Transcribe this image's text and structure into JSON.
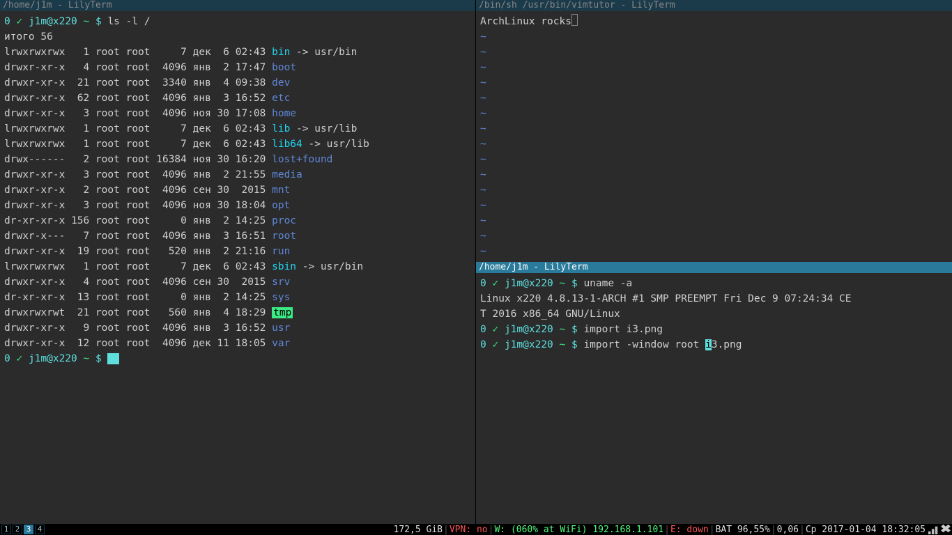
{
  "panes": {
    "left": {
      "title": "/home/j1m - LilyTerm",
      "prompt": {
        "status": "0",
        "tick": "✓",
        "userhost": "j1m@x220",
        "path": "~",
        "dollar": "$"
      },
      "cmd": "ls -l /",
      "total": "итого 56",
      "rows": [
        {
          "perm": "lrwxrwxrwx",
          "lnk": "1",
          "own": "root root",
          "size": "7",
          "mon": "дек",
          "day": "6",
          "time": "02:43",
          "name": "bin",
          "link": " -> usr/bin",
          "cls": "p-cyan"
        },
        {
          "perm": "drwxr-xr-x",
          "lnk": "4",
          "own": "root root",
          "size": "4096",
          "mon": "янв",
          "day": "2",
          "time": "17:47",
          "name": "boot",
          "link": "",
          "cls": "p-blue"
        },
        {
          "perm": "drwxr-xr-x",
          "lnk": "21",
          "own": "root root",
          "size": "3340",
          "mon": "янв",
          "day": "4",
          "time": "09:38",
          "name": "dev",
          "link": "",
          "cls": "p-blue"
        },
        {
          "perm": "drwxr-xr-x",
          "lnk": "62",
          "own": "root root",
          "size": "4096",
          "mon": "янв",
          "day": "3",
          "time": "16:52",
          "name": "etc",
          "link": "",
          "cls": "p-blue"
        },
        {
          "perm": "drwxr-xr-x",
          "lnk": "3",
          "own": "root root",
          "size": "4096",
          "mon": "ноя",
          "day": "30",
          "time": "17:08",
          "name": "home",
          "link": "",
          "cls": "p-blue"
        },
        {
          "perm": "lrwxrwxrwx",
          "lnk": "1",
          "own": "root root",
          "size": "7",
          "mon": "дек",
          "day": "6",
          "time": "02:43",
          "name": "lib",
          "link": " -> usr/lib",
          "cls": "p-cyan"
        },
        {
          "perm": "lrwxrwxrwx",
          "lnk": "1",
          "own": "root root",
          "size": "7",
          "mon": "дек",
          "day": "6",
          "time": "02:43",
          "name": "lib64",
          "link": " -> usr/lib",
          "cls": "p-cyan"
        },
        {
          "perm": "drwx------",
          "lnk": "2",
          "own": "root root",
          "size": "16384",
          "mon": "ноя",
          "day": "30",
          "time": "16:20",
          "name": "lost+found",
          "link": "",
          "cls": "p-blue"
        },
        {
          "perm": "drwxr-xr-x",
          "lnk": "3",
          "own": "root root",
          "size": "4096",
          "mon": "янв",
          "day": "2",
          "time": "21:55",
          "name": "media",
          "link": "",
          "cls": "p-blue"
        },
        {
          "perm": "drwxr-xr-x",
          "lnk": "2",
          "own": "root root",
          "size": "4096",
          "mon": "сен",
          "day": "30",
          "time": " 2015",
          "name": "mnt",
          "link": "",
          "cls": "p-blue"
        },
        {
          "perm": "drwxr-xr-x",
          "lnk": "3",
          "own": "root root",
          "size": "4096",
          "mon": "ноя",
          "day": "30",
          "time": "18:04",
          "name": "opt",
          "link": "",
          "cls": "p-blue"
        },
        {
          "perm": "dr-xr-xr-x",
          "lnk": "156",
          "own": "root root",
          "size": "0",
          "mon": "янв",
          "day": "2",
          "time": "14:25",
          "name": "proc",
          "link": "",
          "cls": "p-blue"
        },
        {
          "perm": "drwxr-x---",
          "lnk": "7",
          "own": "root root",
          "size": "4096",
          "mon": "янв",
          "day": "3",
          "time": "16:51",
          "name": "root",
          "link": "",
          "cls": "p-blue"
        },
        {
          "perm": "drwxr-xr-x",
          "lnk": "19",
          "own": "root root",
          "size": "520",
          "mon": "янв",
          "day": "2",
          "time": "21:16",
          "name": "run",
          "link": "",
          "cls": "p-blue"
        },
        {
          "perm": "lrwxrwxrwx",
          "lnk": "1",
          "own": "root root",
          "size": "7",
          "mon": "дек",
          "day": "6",
          "time": "02:43",
          "name": "sbin",
          "link": " -> usr/bin",
          "cls": "p-cyan"
        },
        {
          "perm": "drwxr-xr-x",
          "lnk": "4",
          "own": "root root",
          "size": "4096",
          "mon": "сен",
          "day": "30",
          "time": " 2015",
          "name": "srv",
          "link": "",
          "cls": "p-blue"
        },
        {
          "perm": "dr-xr-xr-x",
          "lnk": "13",
          "own": "root root",
          "size": "0",
          "mon": "янв",
          "day": "2",
          "time": "14:25",
          "name": "sys",
          "link": "",
          "cls": "p-blue"
        },
        {
          "perm": "drwxrwxrwt",
          "lnk": "21",
          "own": "root root",
          "size": "560",
          "mon": "янв",
          "day": "4",
          "time": "18:29",
          "name": "tmp",
          "link": "",
          "cls": "p-tmp"
        },
        {
          "perm": "drwxr-xr-x",
          "lnk": "9",
          "own": "root root",
          "size": "4096",
          "mon": "янв",
          "day": "3",
          "time": "16:52",
          "name": "usr",
          "link": "",
          "cls": "p-blue"
        },
        {
          "perm": "drwxr-xr-x",
          "lnk": "12",
          "own": "root root",
          "size": "4096",
          "mon": "дек",
          "day": "11",
          "time": "18:05",
          "name": "var",
          "link": "",
          "cls": "p-blue"
        }
      ]
    },
    "right_top": {
      "title": "/bin/sh /usr/bin/vimtutor - LilyTerm",
      "text": "ArchLinux rocks"
    },
    "right_bottom": {
      "title": "/home/j1m - LilyTerm",
      "lines": {
        "cmd1": "uname -a",
        "out1a": "Linux x220 4.8.13-1-ARCH #1 SMP PREEMPT Fri Dec 9 07:24:34 CE",
        "out1b": "T 2016 x86_64 GNU/Linux",
        "cmd2": "import i3.png",
        "cmd3a": "import -window root ",
        "cmd3b": "i",
        "cmd3c": "3.png"
      }
    }
  },
  "workspaces": [
    "1",
    "2",
    "3",
    "4"
  ],
  "active_ws": "3",
  "status": {
    "disk": "172,5 GiB",
    "vpn": "VPN: no",
    "wifi": "W: (060% at WiFi) 192.168.1.101",
    "eth": "E: down",
    "bat": "BAT 96,55%",
    "load": "0,06",
    "date": "Ср 2017-01-04 18:32:05"
  }
}
